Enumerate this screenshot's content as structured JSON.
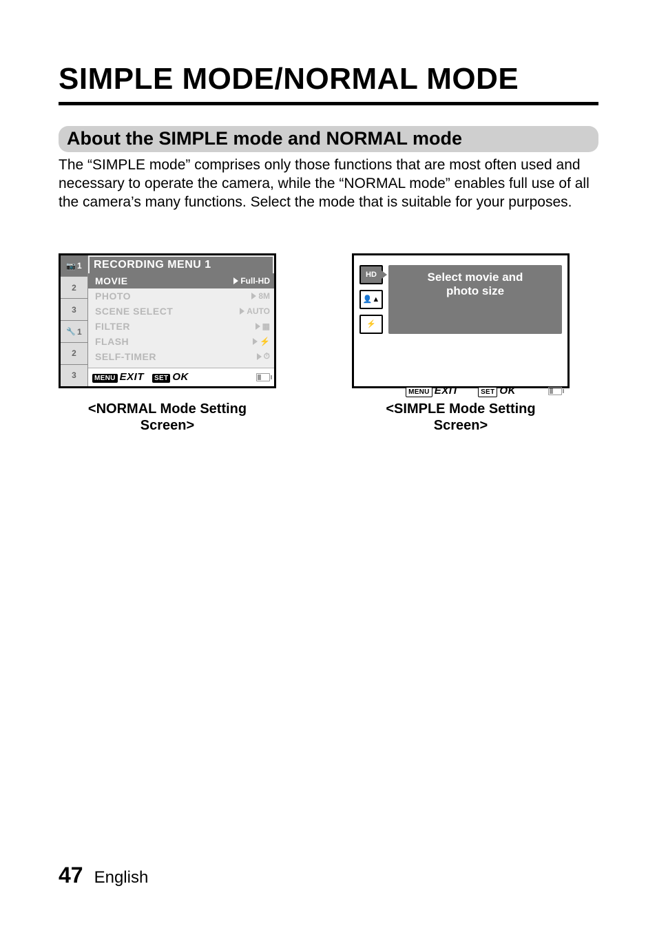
{
  "title": "SIMPLE MODE/NORMAL MODE",
  "section_heading": "About the SIMPLE mode and NORMAL mode",
  "body": "The “SIMPLE mode” comprises only those functions that are most often used and necessary to operate the camera, while the “NORMAL mode” enables full use of all the camera’s many functions. Select the mode that is suitable for your purposes.",
  "normal_screen": {
    "header": "RECORDING MENU 1",
    "tabs": [
      "1",
      "2",
      "3",
      "1",
      "2",
      "3"
    ],
    "items": {
      "movie": "MOVIE",
      "movie_val": "Full-HD",
      "photo": "PHOTO",
      "photo_val": "8M",
      "scene": "SCENE SELECT",
      "scene_val": "AUTO",
      "filter": "FILTER",
      "filter_val": "",
      "flash": "FLASH",
      "flash_val": "",
      "selftimer": "SELF-TIMER",
      "selftimer_val": ""
    },
    "footer": {
      "menu_pill": "MENU",
      "exit": "EXIT",
      "set_pill": "SET",
      "ok": "OK"
    }
  },
  "simple_screen": {
    "desc_line1": "Select movie and",
    "desc_line2": "photo size",
    "hd_label": "HD",
    "footer": {
      "menu_pill": "MENU",
      "exit": "EXIT",
      "set_pill": "SET",
      "ok": "OK"
    }
  },
  "captions": {
    "normal_1": "<NORMAL Mode Setting",
    "normal_2": "Screen>",
    "simple_1": "<SIMPLE Mode Setting",
    "simple_2": "Screen>"
  },
  "footer": {
    "page_number": "47",
    "language": "English"
  }
}
